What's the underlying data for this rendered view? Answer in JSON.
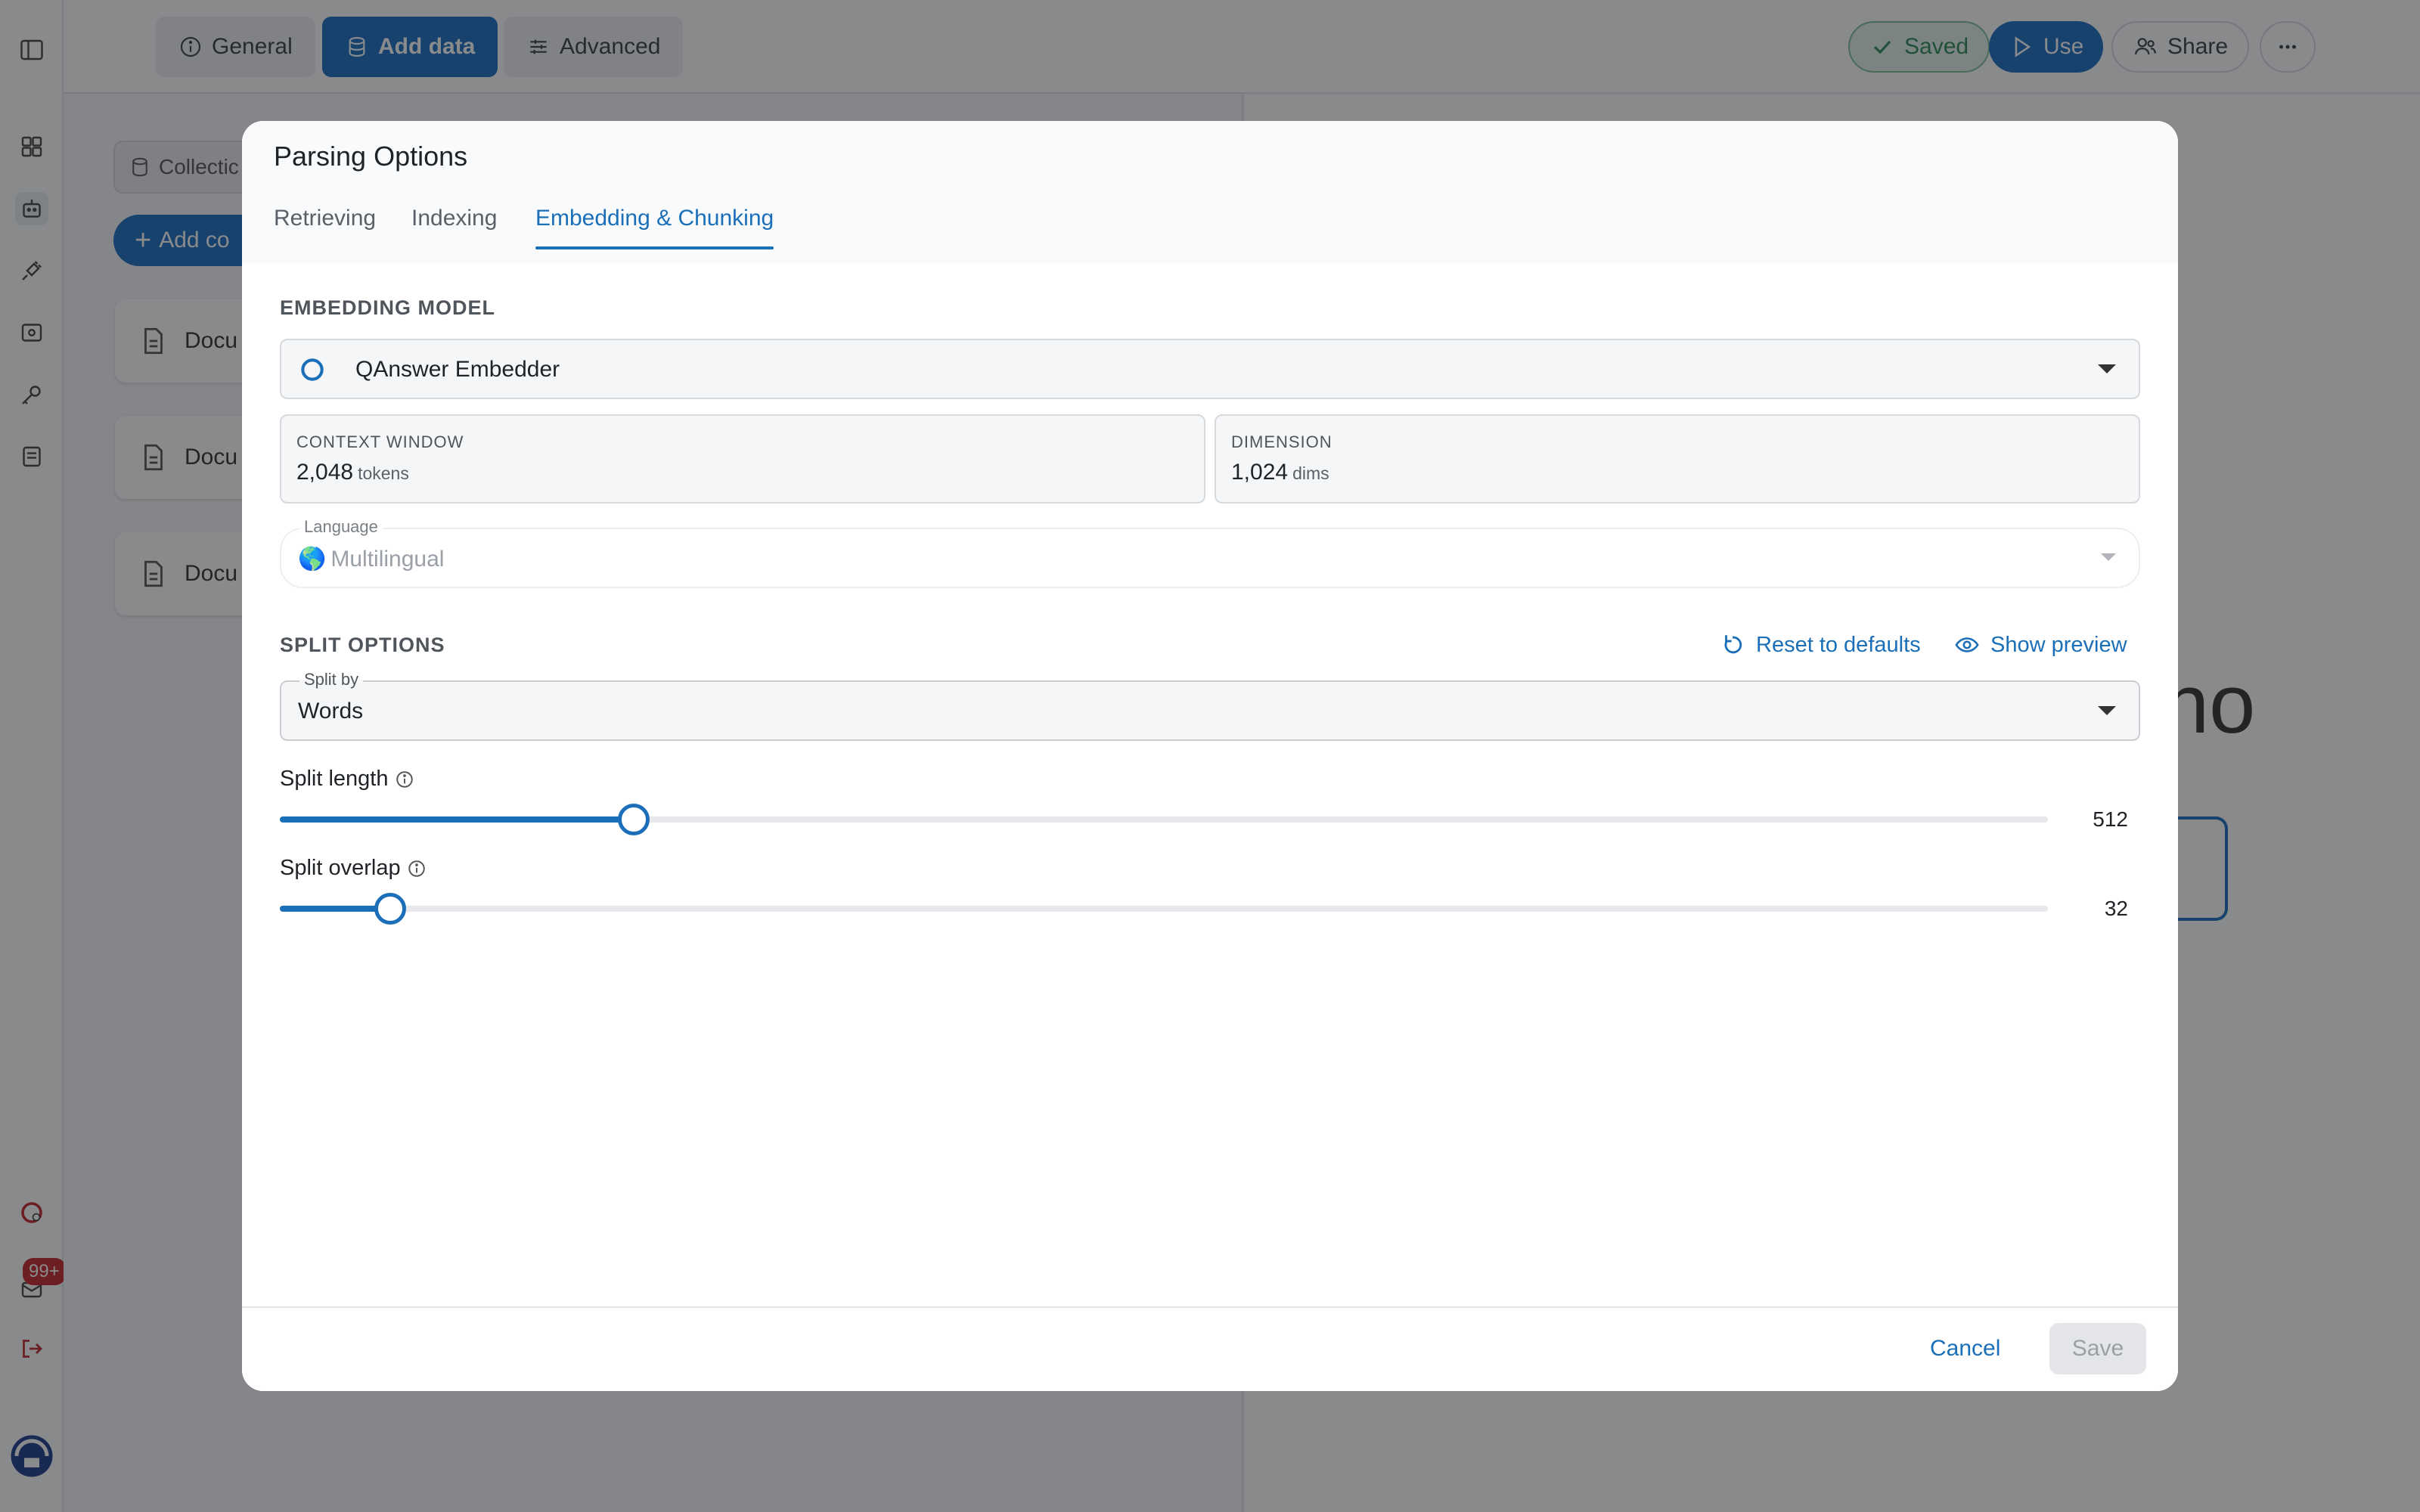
{
  "topbar": {
    "tabs": [
      {
        "label": "General",
        "icon": "info-icon"
      },
      {
        "label": "Add data",
        "icon": "database-icon"
      },
      {
        "label": "Advanced",
        "icon": "sliders-icon"
      }
    ],
    "saved_label": "Saved",
    "use_label": "Use",
    "share_label": "Share"
  },
  "sidebar": {
    "notification_count": "99+"
  },
  "background": {
    "collection_label": "Collectic",
    "add_label": "Add co",
    "docs": [
      "Docu",
      "Docu",
      "Docu"
    ],
    "big_text": "no"
  },
  "modal": {
    "title": "Parsing Options",
    "tabs": [
      {
        "label": "Retrieving"
      },
      {
        "label": "Indexing"
      },
      {
        "label": "Embedding & Chunking",
        "active": true
      }
    ],
    "embedding": {
      "section_label": "EMBEDDING MODEL",
      "model": "QAnswer Embedder",
      "context_window_label": "CONTEXT WINDOW",
      "context_window_value": "2,048",
      "context_window_unit": "tokens",
      "dimension_label": "DIMENSION",
      "dimension_value": "1,024",
      "dimension_unit": "dims",
      "language_label": "Language",
      "language_value": "Multilingual",
      "language_flag": "🌎"
    },
    "split": {
      "section_label": "SPLIT OPTIONS",
      "reset_label": "Reset to defaults",
      "preview_label": "Show preview",
      "split_by_label": "Split by",
      "split_by_value": "Words",
      "length_label": "Split length",
      "length_value": "512",
      "length_fraction": 0.2,
      "overlap_label": "Split overlap",
      "overlap_value": "32",
      "overlap_fraction": 0.0625
    },
    "footer": {
      "cancel_label": "Cancel",
      "save_label": "Save"
    }
  },
  "colors": {
    "accent": "#1a6fb8",
    "saved_green": "#2e8b57",
    "badge_red": "#c4272b"
  }
}
